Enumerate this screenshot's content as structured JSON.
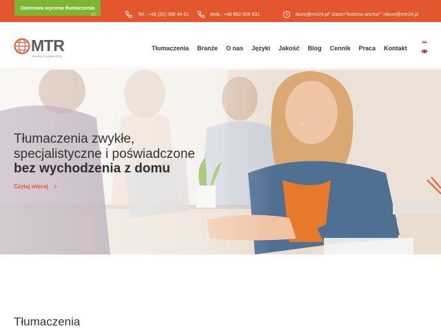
{
  "topbar": {
    "promo_label": "Darmowa wycena tłumaczenia",
    "hidden_phone": "00",
    "phone_tel": "Tel.: +48 (22) 398 44 51",
    "phone_mob": "Mob.: +48 662 906 531",
    "email": "biuro@mtr24.pl\" class=\"buttons-anchor\" >biuro@mtr24.pl",
    "accent_color": "#e4572e",
    "promo_color": "#7ab630"
  },
  "header": {
    "logo_text": "MTR",
    "logo_sub": "BIURO TŁUMACZEŃ",
    "nav": [
      "Tłumaczenia",
      "Branże",
      "O nas",
      "Języki",
      "Jakość",
      "Blog",
      "Cennik",
      "Praca",
      "Kontakt"
    ],
    "languages": [
      "pl-flag-icon",
      "en-flag-icon"
    ]
  },
  "hero": {
    "line1": "Tłumaczenia zwykłe,",
    "line2": "specjalistyczne i poświadczone",
    "line3": "bez wychodzenia z domu",
    "cta": "Czytaj więcej"
  },
  "section": {
    "title": "Tłumaczenia"
  }
}
